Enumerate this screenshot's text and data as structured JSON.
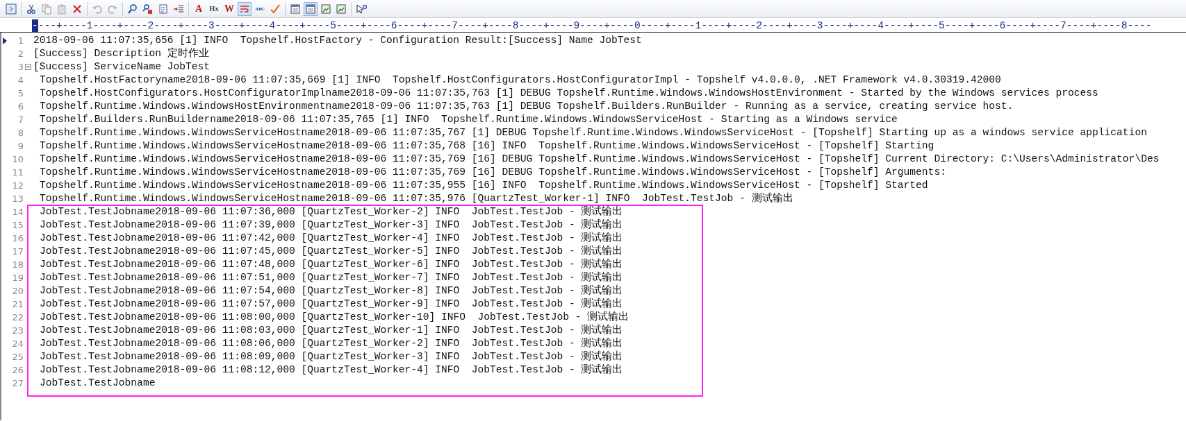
{
  "toolbar": {
    "groups": [
      [
        {
          "kind": "partial",
          "pressed": false
        }
      ],
      [
        {
          "kind": "cut",
          "pressed": false
        },
        {
          "kind": "copy",
          "pressed": false
        },
        {
          "kind": "paste",
          "pressed": false
        },
        {
          "kind": "delete",
          "pressed": false
        }
      ],
      [
        {
          "kind": "undo",
          "pressed": false
        },
        {
          "kind": "redo",
          "pressed": false
        }
      ],
      [
        {
          "kind": "find",
          "pressed": false
        },
        {
          "kind": "replace",
          "pressed": false
        },
        {
          "kind": "goto",
          "pressed": false
        },
        {
          "kind": "numbered",
          "pressed": false
        }
      ],
      [
        {
          "kind": "text",
          "label": "A",
          "pressed": false
        },
        {
          "kind": "text",
          "label": "Hx",
          "pressed": false
        },
        {
          "kind": "text",
          "label": "W",
          "pressed": false
        },
        {
          "kind": "wrap",
          "pressed": true
        },
        {
          "kind": "text",
          "label": "ABC",
          "pressed": false
        },
        {
          "kind": "check",
          "pressed": false
        }
      ],
      [
        {
          "kind": "window",
          "pressed": false
        },
        {
          "kind": "window",
          "pressed": true
        },
        {
          "kind": "export",
          "pressed": false
        },
        {
          "kind": "export",
          "pressed": false
        }
      ],
      [
        {
          "kind": "help",
          "pressed": false
        }
      ]
    ]
  },
  "ruler": {
    "caret_mark": "-",
    "text": "---+----1----+----2----+----3----+----4----+----5----+----6----+----7----+----8----+----9----+----0----+----1----+----2----+----3----+----4----+----5----+----6----+----7----+----8----"
  },
  "lines": [
    {
      "number": "1",
      "current": true,
      "text": "2018-09-06 11:07:35,656 [1] INFO  Topshelf.HostFactory - Configuration Result:[Success] Name JobTest"
    },
    {
      "number": "2",
      "current": false,
      "text": "[Success] Description 定时作业"
    },
    {
      "number": "3",
      "current": false,
      "text": "[Success] ServiceName JobTest",
      "expanded": true,
      "children": [
        {
          "number": "4",
          "current": false,
          "text": "Topshelf.HostFactoryname2018-09-06 11:07:35,669 [1] INFO  Topshelf.HostConfigurators.HostConfiguratorImpl - Topshelf v4.0.0.0, .NET Framework v4.0.30319.42000"
        },
        {
          "number": "5",
          "current": false,
          "text": "Topshelf.HostConfigurators.HostConfiguratorImplname2018-09-06 11:07:35,763 [1] DEBUG Topshelf.Runtime.Windows.WindowsHostEnvironment - Started by the Windows services process"
        },
        {
          "number": "6",
          "current": false,
          "text": "Topshelf.Runtime.Windows.WindowsHostEnvironmentname2018-09-06 11:07:35,763 [1] DEBUG Topshelf.Builders.RunBuilder - Running as a service, creating service host."
        },
        {
          "number": "7",
          "current": false,
          "text": "Topshelf.Builders.RunBuildername2018-09-06 11:07:35,765 [1] INFO  Topshelf.Runtime.Windows.WindowsServiceHost - Starting as a Windows service"
        },
        {
          "number": "8",
          "current": false,
          "text": "Topshelf.Runtime.Windows.WindowsServiceHostname2018-09-06 11:07:35,767 [1] DEBUG Topshelf.Runtime.Windows.WindowsServiceHost - [Topshelf] Starting up as a windows service application"
        },
        {
          "number": "9",
          "current": false,
          "text": "Topshelf.Runtime.Windows.WindowsServiceHostname2018-09-06 11:07:35,768 [16] INFO  Topshelf.Runtime.Windows.WindowsServiceHost - [Topshelf] Starting"
        },
        {
          "number": "10",
          "current": false,
          "text": "Topshelf.Runtime.Windows.WindowsServiceHostname2018-09-06 11:07:35,769 [16] DEBUG Topshelf.Runtime.Windows.WindowsServiceHost - [Topshelf] Current Directory: C:\\Users\\Administrator\\Des"
        },
        {
          "number": "11",
          "current": false,
          "text": "Topshelf.Runtime.Windows.WindowsServiceHostname2018-09-06 11:07:35,769 [16] DEBUG Topshelf.Runtime.Windows.WindowsServiceHost - [Topshelf] Arguments:"
        },
        {
          "number": "12",
          "current": false,
          "text": "Topshelf.Runtime.Windows.WindowsServiceHostname2018-09-06 11:07:35,955 [16] INFO  Topshelf.Runtime.Windows.WindowsServiceHost - [Topshelf] Started"
        },
        {
          "number": "13",
          "current": false,
          "text": "Topshelf.Runtime.Windows.WindowsServiceHostname2018-09-06 11:07:35,976 [QuartzTest_Worker-1] INFO  JobTest.TestJob - 测试输出"
        },
        {
          "number": "14",
          "current": false,
          "text": "JobTest.TestJobname2018-09-06 11:07:36,000 [QuartzTest_Worker-2] INFO  JobTest.TestJob - 测试输出"
        },
        {
          "number": "15",
          "current": false,
          "text": "JobTest.TestJobname2018-09-06 11:07:39,000 [QuartzTest_Worker-3] INFO  JobTest.TestJob - 测试输出"
        },
        {
          "number": "16",
          "current": false,
          "text": "JobTest.TestJobname2018-09-06 11:07:42,000 [QuartzTest_Worker-4] INFO  JobTest.TestJob - 测试输出"
        },
        {
          "number": "17",
          "current": false,
          "text": "JobTest.TestJobname2018-09-06 11:07:45,000 [QuartzTest_Worker-5] INFO  JobTest.TestJob - 测试输出"
        },
        {
          "number": "18",
          "current": false,
          "text": "JobTest.TestJobname2018-09-06 11:07:48,000 [QuartzTest_Worker-6] INFO  JobTest.TestJob - 测试输出"
        },
        {
          "number": "19",
          "current": false,
          "text": "JobTest.TestJobname2018-09-06 11:07:51,000 [QuartzTest_Worker-7] INFO  JobTest.TestJob - 测试输出"
        },
        {
          "number": "20",
          "current": false,
          "text": "JobTest.TestJobname2018-09-06 11:07:54,000 [QuartzTest_Worker-8] INFO  JobTest.TestJob - 测试输出"
        },
        {
          "number": "21",
          "current": false,
          "text": "JobTest.TestJobname2018-09-06 11:07:57,000 [QuartzTest_Worker-9] INFO  JobTest.TestJob - 测试输出"
        },
        {
          "number": "22",
          "current": false,
          "text": "JobTest.TestJobname2018-09-06 11:08:00,000 [QuartzTest_Worker-10] INFO  JobTest.TestJob - 测试输出"
        },
        {
          "number": "23",
          "current": false,
          "text": "JobTest.TestJobname2018-09-06 11:08:03,000 [QuartzTest_Worker-1] INFO  JobTest.TestJob - 测试输出"
        },
        {
          "number": "24",
          "current": false,
          "text": "JobTest.TestJobname2018-09-06 11:08:06,000 [QuartzTest_Worker-2] INFO  JobTest.TestJob - 测试输出"
        },
        {
          "number": "25",
          "current": false,
          "text": "JobTest.TestJobname2018-09-06 11:08:09,000 [QuartzTest_Worker-3] INFO  JobTest.TestJob - 测试输出"
        },
        {
          "number": "26",
          "current": false,
          "text": "JobTest.TestJobname2018-09-06 11:08:12,000 [QuartzTest_Worker-4] INFO  JobTest.TestJob - 测试输出"
        },
        {
          "number": "27",
          "current": false,
          "text": "JobTest.TestJobname"
        }
      ]
    }
  ],
  "annotation": {
    "kind": "frame"
  }
}
